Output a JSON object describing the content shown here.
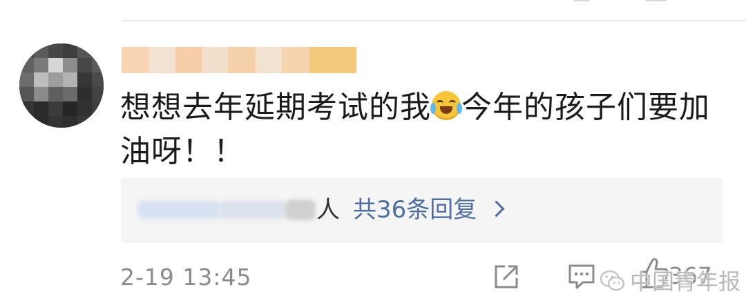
{
  "comment": {
    "username": "",
    "text_part1": "想想去年延期考试的我",
    "emoji": "crying-laughing-emoji",
    "text_part2": "今年的孩子们要加油呀！！"
  },
  "replies": {
    "person_suffix": "人",
    "count_label": "共36条回复"
  },
  "footer": {
    "timestamp": "2-19 13:45",
    "like_count": "367"
  },
  "watermark": {
    "text": "中国青年报"
  },
  "colors": {
    "link": "#4c6ea3",
    "text": "#1b1b1b",
    "meta": "#8a8a8a",
    "reply_bg": "#f5f5f5",
    "username_blur": "#f6d7b6"
  },
  "icons": [
    "share-icon",
    "comment-icon",
    "like-icon",
    "chevron-right-icon",
    "wechat-icon"
  ]
}
